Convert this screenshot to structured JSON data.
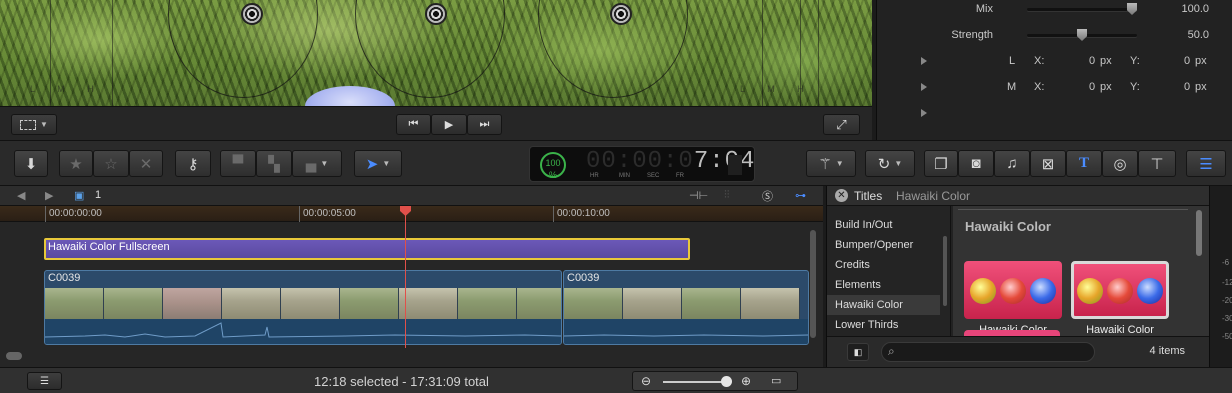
{
  "viewer": {
    "wheel_labels_left": "L M H",
    "wheel_labels_right": "L M H"
  },
  "inspector": {
    "mix_label": "Mix",
    "mix_value": "100.0",
    "mix_level": 1.0,
    "strength_label": "Strength",
    "strength_value": "50.0",
    "strength_level": 0.5,
    "rows": [
      {
        "name": "L",
        "x_label": "X:",
        "x_value": "0",
        "x_unit": "px",
        "y_label": "Y:",
        "y_value": "0",
        "y_unit": "px"
      },
      {
        "name": "M",
        "x_label": "X:",
        "x_value": "0",
        "x_unit": "px",
        "y_label": "Y:",
        "y_value": "0",
        "y_unit": "px"
      }
    ]
  },
  "dashboard": {
    "percent": "100",
    "percent_sign": "%",
    "timecode_dim": "00:00:0",
    "timecode_lit": "7:04",
    "units": [
      "HR",
      "MIN",
      "SEC",
      "FR"
    ]
  },
  "timeline": {
    "project_index": "1",
    "ruler": [
      "00:00:00:00",
      "00:00:05:00",
      "00:00:10:00"
    ],
    "title_clip": "Hawaiki Color Fullscreen",
    "clips": [
      {
        "name": "C0039"
      },
      {
        "name": "C0039"
      }
    ]
  },
  "browser": {
    "header_title": "Titles",
    "header_subtitle": "Hawaiki Color",
    "categories": [
      "Build In/Out",
      "Bumper/Opener",
      "Credits",
      "Elements",
      "Hawaiki Color",
      "Lower Thirds"
    ],
    "selected_category": "Hawaiki Color",
    "section_title": "Hawaiki Color",
    "items": [
      "Hawaiki Color",
      "Hawaiki Color Fullscreen"
    ],
    "count": "4 items"
  },
  "meters": {
    "labels": [
      "-6",
      "-12",
      "-20",
      "-30",
      "-50"
    ]
  },
  "status": {
    "text": "12:18 selected - 17:31:09 total"
  },
  "colors": {
    "title_clip": "#6b58b8",
    "title_border": "#e8c83a",
    "video_clip": "#2c4a6a",
    "playhead": "#e0504a",
    "dashboard_green": "#3bb34a",
    "tool_blue": "#4a8cff"
  }
}
